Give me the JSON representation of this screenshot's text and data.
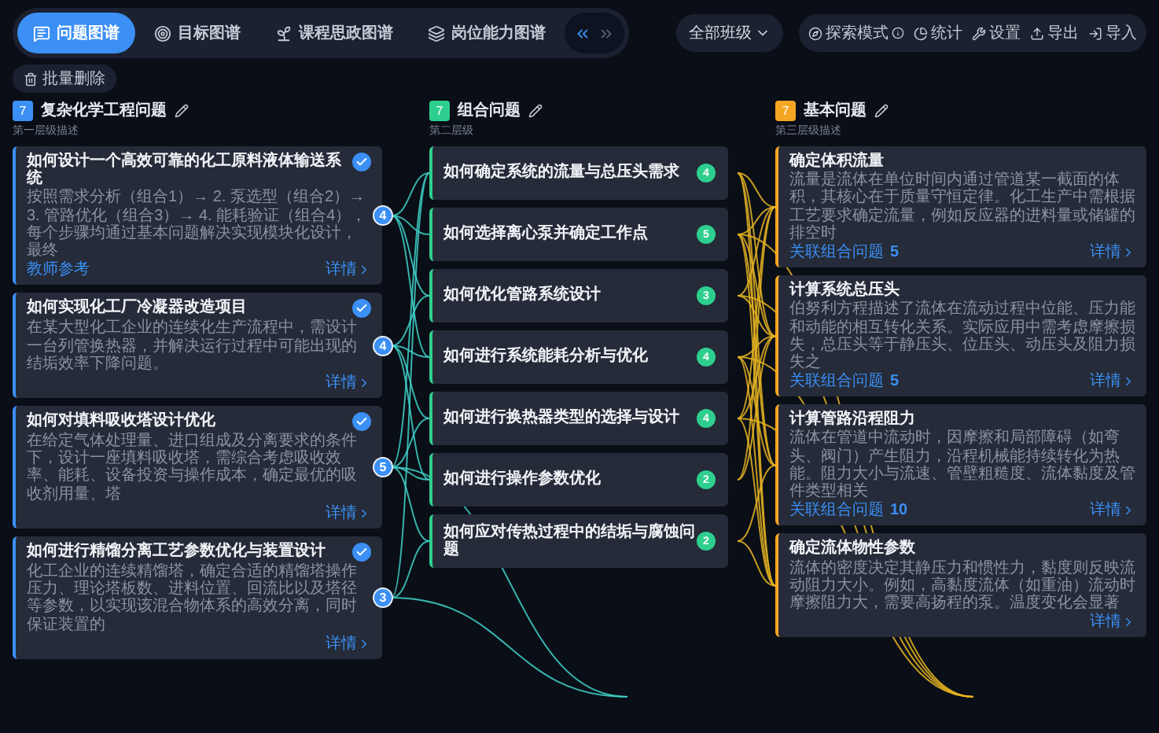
{
  "tabs": [
    {
      "label": "问题图谱",
      "kind": "question",
      "selected": true
    },
    {
      "label": "目标图谱",
      "kind": "target",
      "selected": false
    },
    {
      "label": "课程思政图谱",
      "kind": "course",
      "selected": false
    },
    {
      "label": "岗位能力图谱",
      "kind": "ability",
      "selected": false
    }
  ],
  "collapse_toggle": [
    {
      "kind": "left",
      "selected": true
    },
    {
      "kind": "right",
      "selected": false
    }
  ],
  "class_filter": {
    "value": "全部班级"
  },
  "toolbar": [
    {
      "label": "探索模式",
      "kind": "explore"
    },
    {
      "label": "统计",
      "kind": "stats"
    },
    {
      "label": "设置",
      "kind": "settings"
    },
    {
      "label": "导出",
      "kind": "export"
    },
    {
      "label": "导入",
      "kind": "import"
    }
  ],
  "batch_delete": "批量删除",
  "columns": [
    {
      "kind": "complex",
      "count": "7",
      "color": "#3b8ff5",
      "title": "复杂化学工程问题",
      "subtitle": "第一层级描述",
      "cards": [
        {
          "title": "如何设计一个高效可靠的化工原料液体输送系统",
          "description": "按照需求分析（组合1）→ 2. 泵选型（组合2）→ 3. 管路优化（组合3）→ 4. 能耗验证（组合4），每个步骤均通过基本问题解决实现模块化设计，最终",
          "detail": "详情",
          "links": "4",
          "checked": true,
          "footer": "教师参考"
        },
        {
          "title": "如何实现化工厂冷凝器改造项目",
          "description": "在某大型化工企业的连续化生产流程中，需设计一台列管换热器，并解决运行过程中可能出现的结垢效率下降问题。",
          "detail": "详情",
          "links": "4",
          "checked": true
        },
        {
          "title": "如何对填料吸收塔设计优化",
          "description": "在给定气体处理量、进口组成及分离要求的条件下，设计一座填料吸收塔，需综合考虑吸收效率、能耗、设备投资与操作成本，确定最优的吸收剂用量、塔",
          "detail": "详情",
          "links": "5",
          "checked": true
        },
        {
          "title": "如何进行精馏分离工艺参数优化与装置设计",
          "description": "化工企业的连续精馏塔，确定合适的精馏塔操作压力、理论塔板数、进料位置、回流比以及塔径等参数，以实现该混合物体系的高效分离，同时保证装置的",
          "detail": "详情",
          "links": "3",
          "checked": true
        }
      ]
    },
    {
      "kind": "combo",
      "count": "7",
      "color": "#2ecf8e",
      "title": "组合问题",
      "subtitle": "第二层级",
      "cards": [
        {
          "title": "如何确定系统的流量与总压头需求",
          "links": "4"
        },
        {
          "title": "如何选择离心泵并确定工作点",
          "links": "5"
        },
        {
          "title": "如何优化管路系统设计",
          "links": "3"
        },
        {
          "title": "如何进行系统能耗分析与优化",
          "links": "4"
        },
        {
          "title": "如何进行换热器类型的选择与设计",
          "links": "4"
        },
        {
          "title": "如何进行操作参数优化",
          "links": "2"
        },
        {
          "title": "如何应对传热过程中的结垢与腐蚀问题",
          "links": "2"
        }
      ]
    },
    {
      "kind": "basic",
      "count": "7",
      "color": "#f5a623",
      "title": "基本问题",
      "subtitle": "第三层级描述",
      "cards": [
        {
          "title": "确定体积流量",
          "description": "流量是流体在单位时间内通过管道某一截面的体积，其核心在于质量守恒定律。化工生产中需根据工艺要求确定流量，例如反应器的进料量或储罐的排空时",
          "detail": "详情",
          "footer": "关联组合问题",
          "links": "5"
        },
        {
          "title": "计算系统总压头",
          "description": "伯努利方程描述了流体在流动过程中位能、压力能和动能的相互转化关系。实际应用中需考虑摩擦损失，总压头等于静压头、位压头、动压头及阻力损失之",
          "detail": "详情",
          "footer": "关联组合问题",
          "links": "5"
        },
        {
          "title": "计算管路沿程阻力",
          "description": "流体在管道中流动时，因摩擦和局部障碍（如弯头、阀门）产生阻力，沿程机械能持续转化为热能。阻力大小与流速、管壁粗糙度、流体黏度及管件类型相关",
          "detail": "详情",
          "footer": "关联组合问题",
          "links": "10"
        },
        {
          "title": "确定流体物性参数",
          "description": "流体的密度决定其静压力和惯性力，黏度则反映流动阻力大小。例如，高黏度流体（如重油）流动时摩擦阻力大，需要高扬程的泵。温度变化会显著",
          "detail": "详情"
        }
      ]
    }
  ]
}
